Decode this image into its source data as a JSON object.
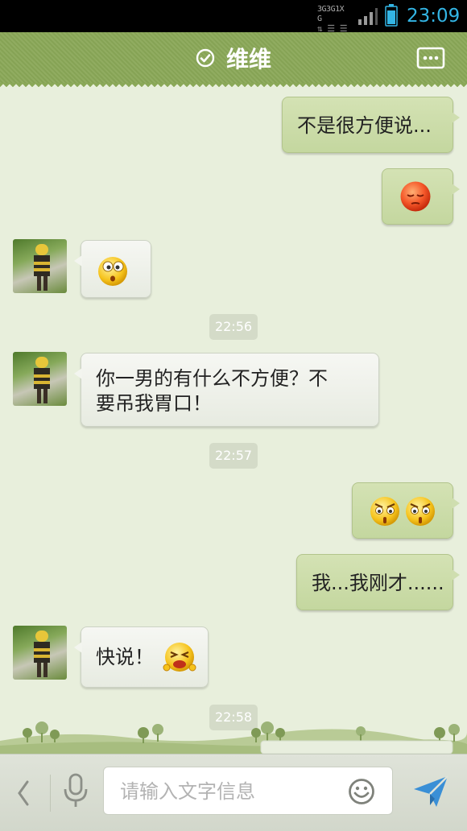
{
  "status_bar": {
    "network_labels": [
      "3G",
      "3G",
      "1X",
      "G"
    ],
    "time": "23:09"
  },
  "header": {
    "title": "维维",
    "verified_icon": "check-circle-icon",
    "menu_icon": "more-dots-icon"
  },
  "messages": [
    {
      "side": "out",
      "type": "text",
      "text": "不是很方便说..."
    },
    {
      "side": "out",
      "type": "emoji",
      "emoji": "sad-face"
    },
    {
      "side": "in",
      "type": "emoji",
      "emoji": "surprised-face"
    },
    {
      "side": "time",
      "text": "22:56"
    },
    {
      "side": "in",
      "type": "text",
      "lines": [
        "你一男的有什么不方便？不",
        "要吊我胃口！"
      ]
    },
    {
      "side": "time",
      "text": "22:57"
    },
    {
      "side": "out",
      "type": "emoji",
      "emoji": "angry-face"
    },
    {
      "side": "out",
      "type": "text",
      "text": "我...我刚才......"
    },
    {
      "side": "in",
      "type": "text",
      "text": "快说！",
      "emoji": "pleading-face"
    },
    {
      "side": "time",
      "text": "22:58"
    }
  ],
  "input_bar": {
    "placeholder": "请输入文字信息",
    "value": "",
    "back_icon": "chevron-left-icon",
    "voice_icon": "microphone-icon",
    "emoji_icon": "smiley-icon",
    "send_icon": "send-icon"
  },
  "colors": {
    "header": "#8aa858",
    "chat_bg": "#e8efdc",
    "outgoing_bubble": "#cadbaa",
    "time_accent": "#33b5e5"
  }
}
